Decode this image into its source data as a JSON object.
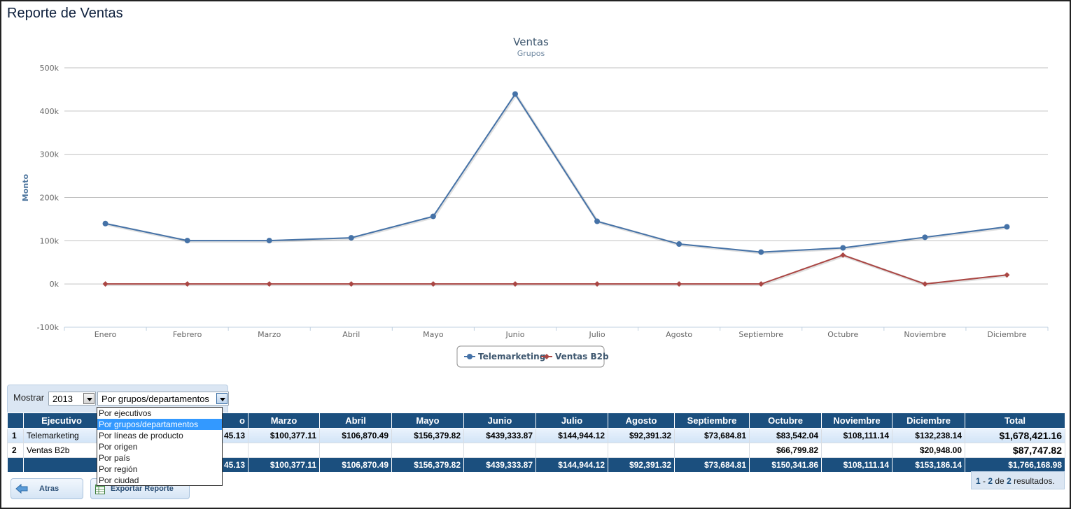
{
  "page": {
    "title": "Reporte de Ventas"
  },
  "chart_data": {
    "type": "line",
    "title": "Ventas",
    "subtitle": "Grupos",
    "ylabel": "Monto",
    "xlabel": "",
    "ylim": [
      -100000,
      500000
    ],
    "yticks": [
      -100000,
      0,
      100000,
      200000,
      300000,
      400000,
      500000
    ],
    "ytick_labels": [
      "-100k",
      "0k",
      "100k",
      "200k",
      "300k",
      "400k",
      "500k"
    ],
    "categories": [
      "Enero",
      "Febrero",
      "Marzo",
      "Abril",
      "Mayo",
      "Junio",
      "Julio",
      "Agosto",
      "Septiembre",
      "Octubre",
      "Noviembre",
      "Diciembre"
    ],
    "grid": true,
    "legend": "bottom-center",
    "series": [
      {
        "name": "Telemarketing",
        "color": "#4572a7",
        "marker": "circle",
        "values": [
          139745.13,
          100377.11,
          100377.11,
          106870.49,
          156379.82,
          439333.87,
          144944.12,
          92391.32,
          73684.81,
          83542.04,
          108111.14,
          132238.14
        ]
      },
      {
        "name": "Ventas B2b",
        "color": "#aa4643",
        "marker": "diamond",
        "values": [
          0,
          0,
          0,
          0,
          0,
          0,
          0,
          0,
          0,
          66799.82,
          0,
          20948.0
        ]
      }
    ]
  },
  "controls": {
    "label": "Mostrar",
    "year": "2013",
    "grouping": "Por grupos/departamentos",
    "options": [
      "Por ejecutivos",
      "Por grupos/departamentos",
      "Por líneas de producto",
      "Por origen",
      "Por país",
      "Por región",
      "Por ciudad"
    ],
    "selected_index": 1
  },
  "table": {
    "headers": [
      "",
      "Ejecutivo",
      "",
      "",
      "Marzo",
      "Abril",
      "Mayo",
      "Junio",
      "Julio",
      "Agosto",
      "Septiembre",
      "Octubre",
      "Noviembre",
      "Diciembre",
      "Total"
    ],
    "header_visible": [
      "Ejecutivo",
      "o",
      "Marzo",
      "Abril",
      "Mayo",
      "Junio",
      "Julio",
      "Agosto",
      "Septiembre",
      "Octubre",
      "Noviembre",
      "Diciembre",
      "Total"
    ],
    "rows": [
      {
        "idx": "1",
        "name": "Telemarketing",
        "feb": "45.13",
        "values": [
          "$100,377.11",
          "$106,870.49",
          "$156,379.82",
          "$439,333.87",
          "$144,944.12",
          "$92,391.32",
          "$73,684.81",
          "$83,542.04",
          "$108,111.14",
          "$132,238.14"
        ],
        "total": "$1,678,421.16"
      },
      {
        "idx": "2",
        "name": "Ventas B2b",
        "feb": "",
        "values": [
          "",
          "",
          "",
          "",
          "",
          "",
          "",
          "$66,799.82",
          "",
          "$20,948.00"
        ],
        "total": "$87,747.82"
      }
    ],
    "totals": {
      "feb": "45.13",
      "values": [
        "$100,377.11",
        "$106,870.49",
        "$156,379.82",
        "$439,333.87",
        "$144,944.12",
        "$92,391.32",
        "$73,684.81",
        "$150,341.86",
        "$108,111.14",
        "$153,186.14"
      ],
      "total": "$1,766,168.98"
    }
  },
  "buttons": {
    "back": "Atras",
    "export": "Exportar Reporte"
  },
  "pager": {
    "from": "1",
    "sep": " - ",
    "to": "2",
    "of": " de ",
    "count": "2",
    "suffix": " resultados."
  }
}
